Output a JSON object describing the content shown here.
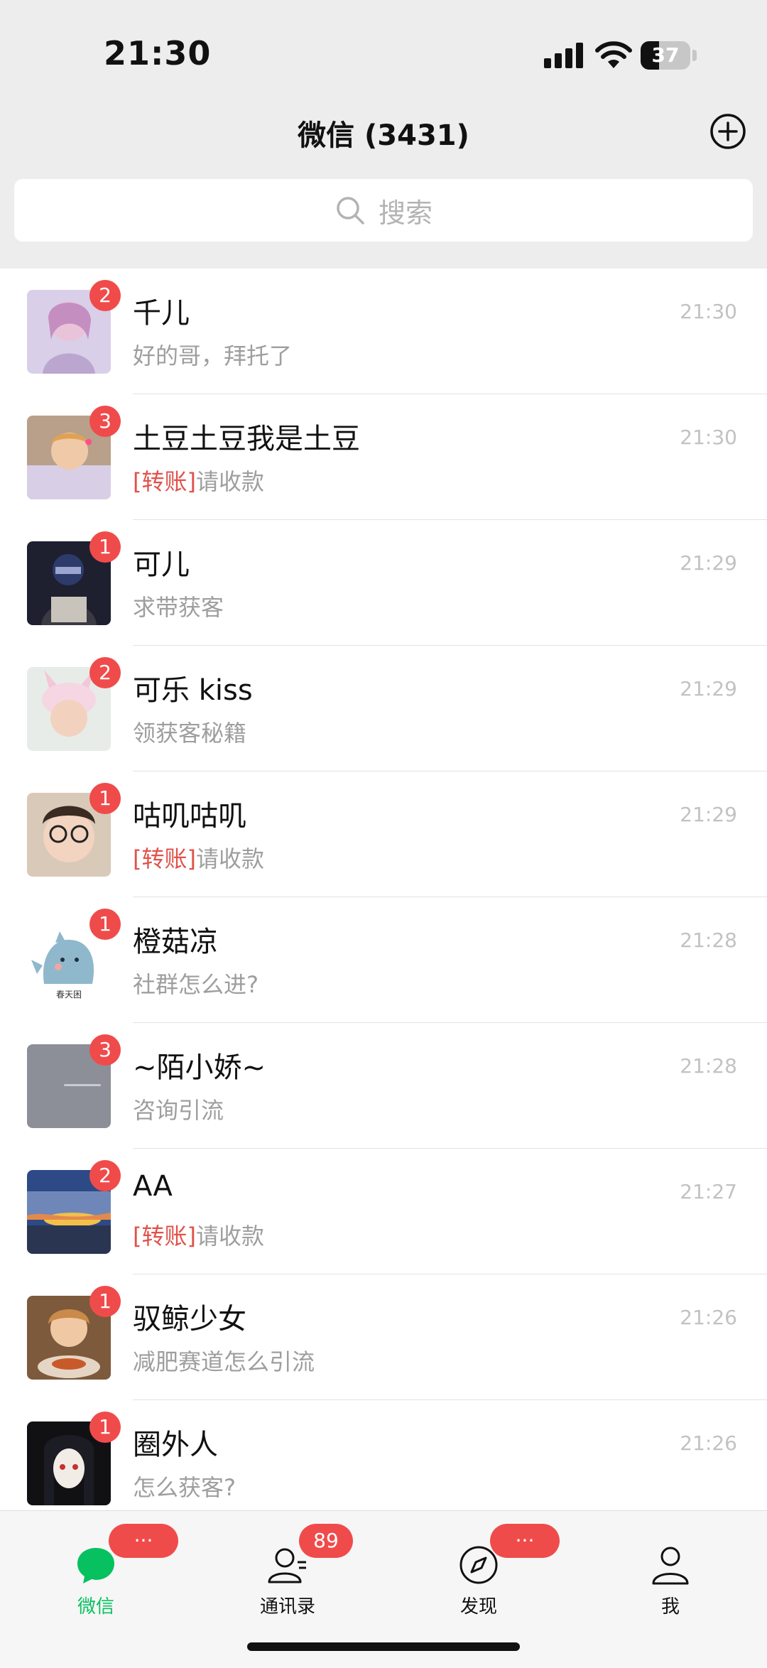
{
  "status_bar": {
    "time": "21:30",
    "battery_level": "37",
    "battery_fraction": 0.37
  },
  "nav": {
    "title": "微信 (3431)"
  },
  "search": {
    "placeholder": "搜索"
  },
  "chats": [
    {
      "name": "千儿",
      "time": "21:30",
      "tag": "",
      "preview": "好的哥，拜托了",
      "unread": "2"
    },
    {
      "name": "土豆土豆我是土豆",
      "time": "21:30",
      "tag": "[转账]",
      "preview": "请收款",
      "unread": "3"
    },
    {
      "name": "可儿",
      "time": "21:29",
      "tag": "",
      "preview": "求带获客",
      "unread": "1"
    },
    {
      "name": "可乐 kiss",
      "time": "21:29",
      "tag": "",
      "preview": "领获客秘籍",
      "unread": "2"
    },
    {
      "name": "咕叽咕叽",
      "time": "21:29",
      "tag": "[转账]",
      "preview": "请收款",
      "unread": "1"
    },
    {
      "name": "橙菇凉",
      "time": "21:28",
      "tag": "",
      "preview": "社群怎么进?",
      "unread": "1"
    },
    {
      "name": "~陌小娇~",
      "time": "21:28",
      "tag": "",
      "preview": "咨询引流",
      "unread": "3"
    },
    {
      "name": "AA",
      "time": "21:27",
      "tag": "[转账]",
      "preview": "请收款",
      "unread": "2"
    },
    {
      "name": "驭鲸少女",
      "time": "21:26",
      "tag": "",
      "preview": "减肥赛道怎么引流",
      "unread": "1"
    },
    {
      "name": "圈外人",
      "time": "21:26",
      "tag": "",
      "preview": "怎么获客?",
      "unread": "1"
    }
  ],
  "avatar_caption_chengguliang": "春天困",
  "tabs": [
    {
      "label": "微信",
      "badge": "···",
      "active": true
    },
    {
      "label": "通讯录",
      "badge": "89",
      "active": false
    },
    {
      "label": "发现",
      "badge": "···",
      "active": false
    },
    {
      "label": "我",
      "badge": "",
      "active": false
    }
  ],
  "colors": {
    "accent_green": "#07c160",
    "badge_red": "#f04b4b",
    "transfer_tag": "#e0524a"
  }
}
